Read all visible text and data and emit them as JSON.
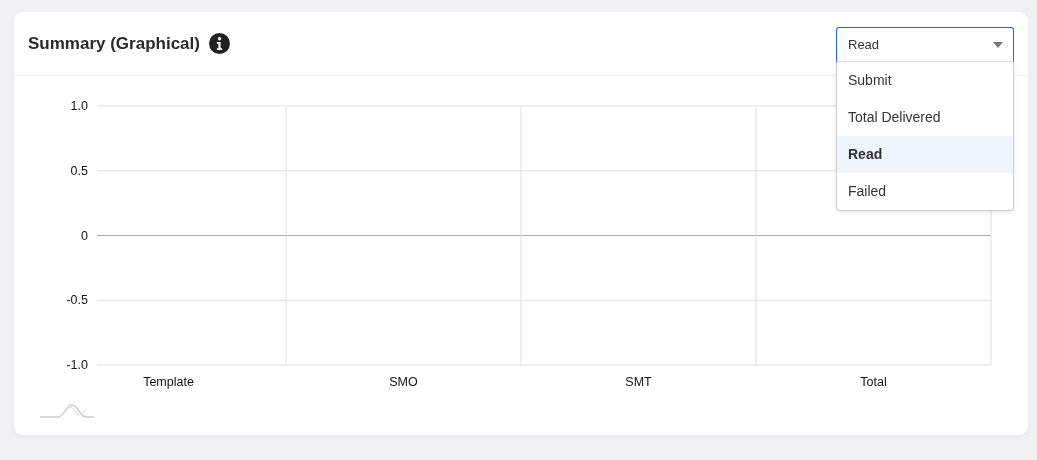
{
  "panel": {
    "title": "Summary (Graphical)",
    "dropdown": {
      "value": "Read",
      "expanded": true,
      "options": [
        {
          "label": "Submit",
          "selected": false
        },
        {
          "label": "Total Delivered",
          "selected": false
        },
        {
          "label": "Read",
          "selected": true
        },
        {
          "label": "Failed",
          "selected": false
        }
      ]
    },
    "chart_data": {
      "type": "bar",
      "categories": [
        "Template",
        "SMO",
        "SMT",
        "Total"
      ],
      "values": [
        null,
        null,
        null,
        null
      ],
      "ylim": [
        -1,
        1
      ],
      "yticks": [
        {
          "value": 1,
          "label": "1.0"
        },
        {
          "value": 0.5,
          "label": "0.5"
        },
        {
          "value": 0,
          "label": "0"
        },
        {
          "value": -0.5,
          "label": "-0.5"
        },
        {
          "value": -1,
          "label": "-1.0"
        }
      ]
    }
  }
}
